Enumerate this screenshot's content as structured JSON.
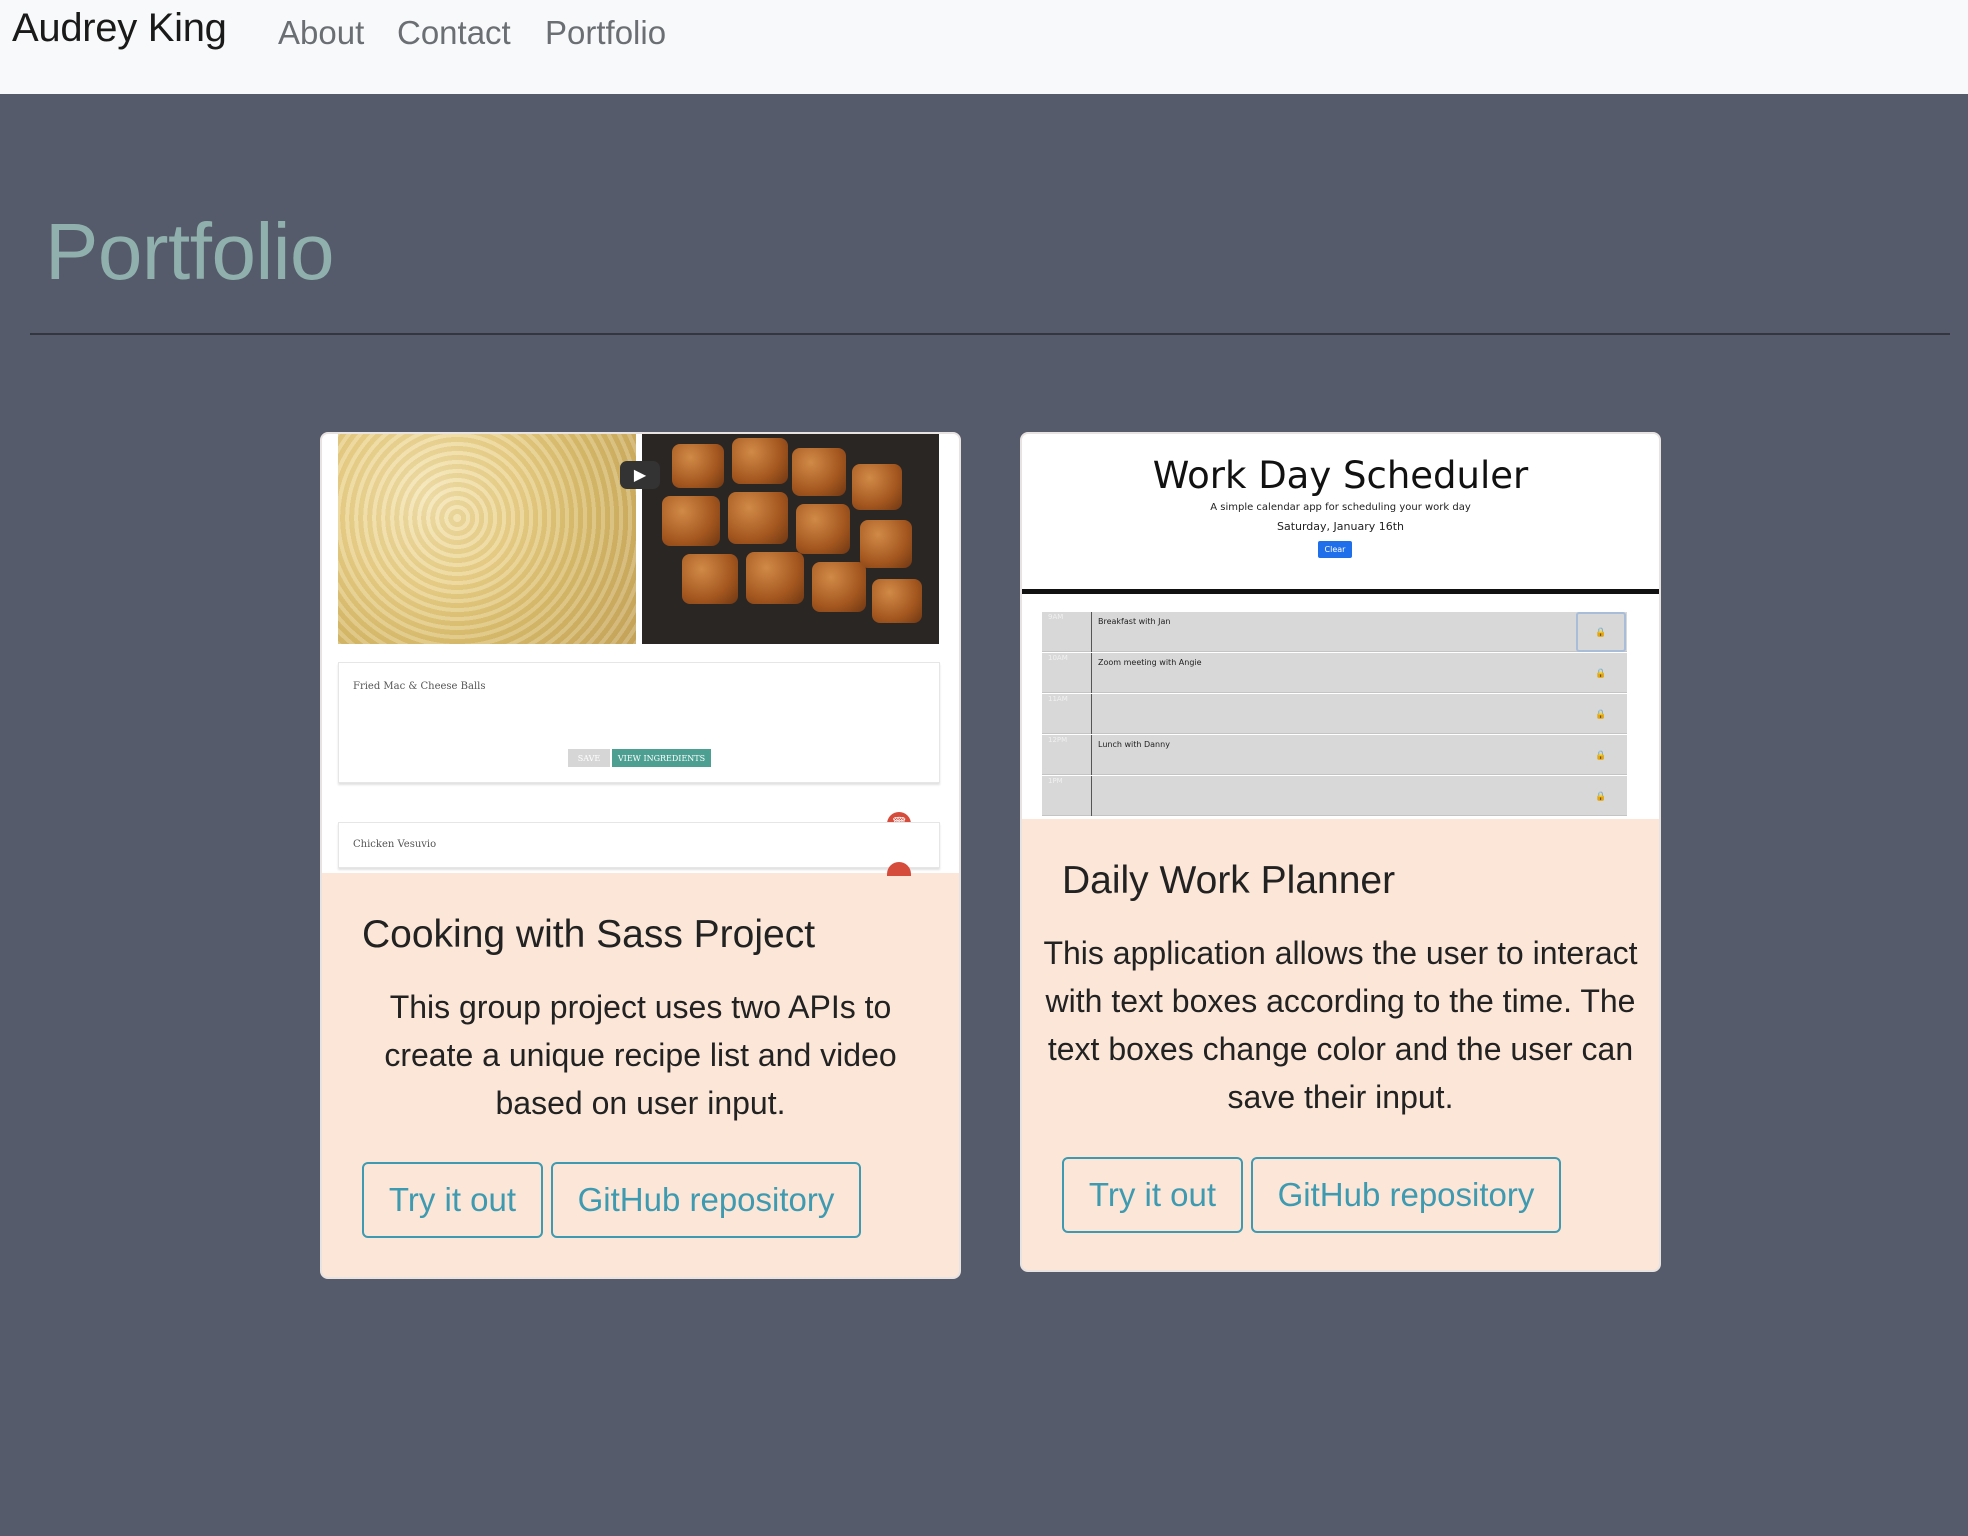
{
  "nav": {
    "brand": "Audrey King",
    "links": [
      "About",
      "Contact",
      "Portfolio"
    ]
  },
  "page": {
    "title": "Portfolio"
  },
  "cards": [
    {
      "title": "Cooking with Sass Project",
      "text": "This group project uses two APIs to create a unique recipe list and video based on user input.",
      "buttons": [
        "Try it out",
        "GitHub repository"
      ],
      "screenshot": {
        "recipe_1": "Fried Mac & Cheese Balls",
        "save_label": "SAVE",
        "view_label": "VIEW INGREDIENTS",
        "recipe_2": "Chicken Vesuvio",
        "play_icon": "play-icon",
        "trash_icon": "trash-icon"
      }
    },
    {
      "title": "Daily Work Planner",
      "text": "This application allows the user to interact with text boxes according to the time. The text boxes change color and the user can save their input.",
      "buttons": [
        "Try it out",
        "GitHub repository"
      ],
      "screenshot": {
        "title": "Work Day Scheduler",
        "subtitle": "A simple calendar app for scheduling your work day",
        "date": "Saturday, January 16th",
        "clear_label": "Clear",
        "rows": [
          {
            "hour": "9AM",
            "text": "Breakfast with Jan"
          },
          {
            "hour": "10AM",
            "text": "Zoom meeting with Angie"
          },
          {
            "hour": "11AM",
            "text": ""
          },
          {
            "hour": "12PM",
            "text": "Lunch with Danny"
          },
          {
            "hour": "1PM",
            "text": ""
          }
        ],
        "save_icon": "lock-icon"
      }
    }
  ],
  "colors": {
    "background": "#565b6b",
    "navbar": "#f8f9fa",
    "title": "#8fb0ac",
    "card": "#fbe6d8",
    "button": "#3e9ab0"
  }
}
